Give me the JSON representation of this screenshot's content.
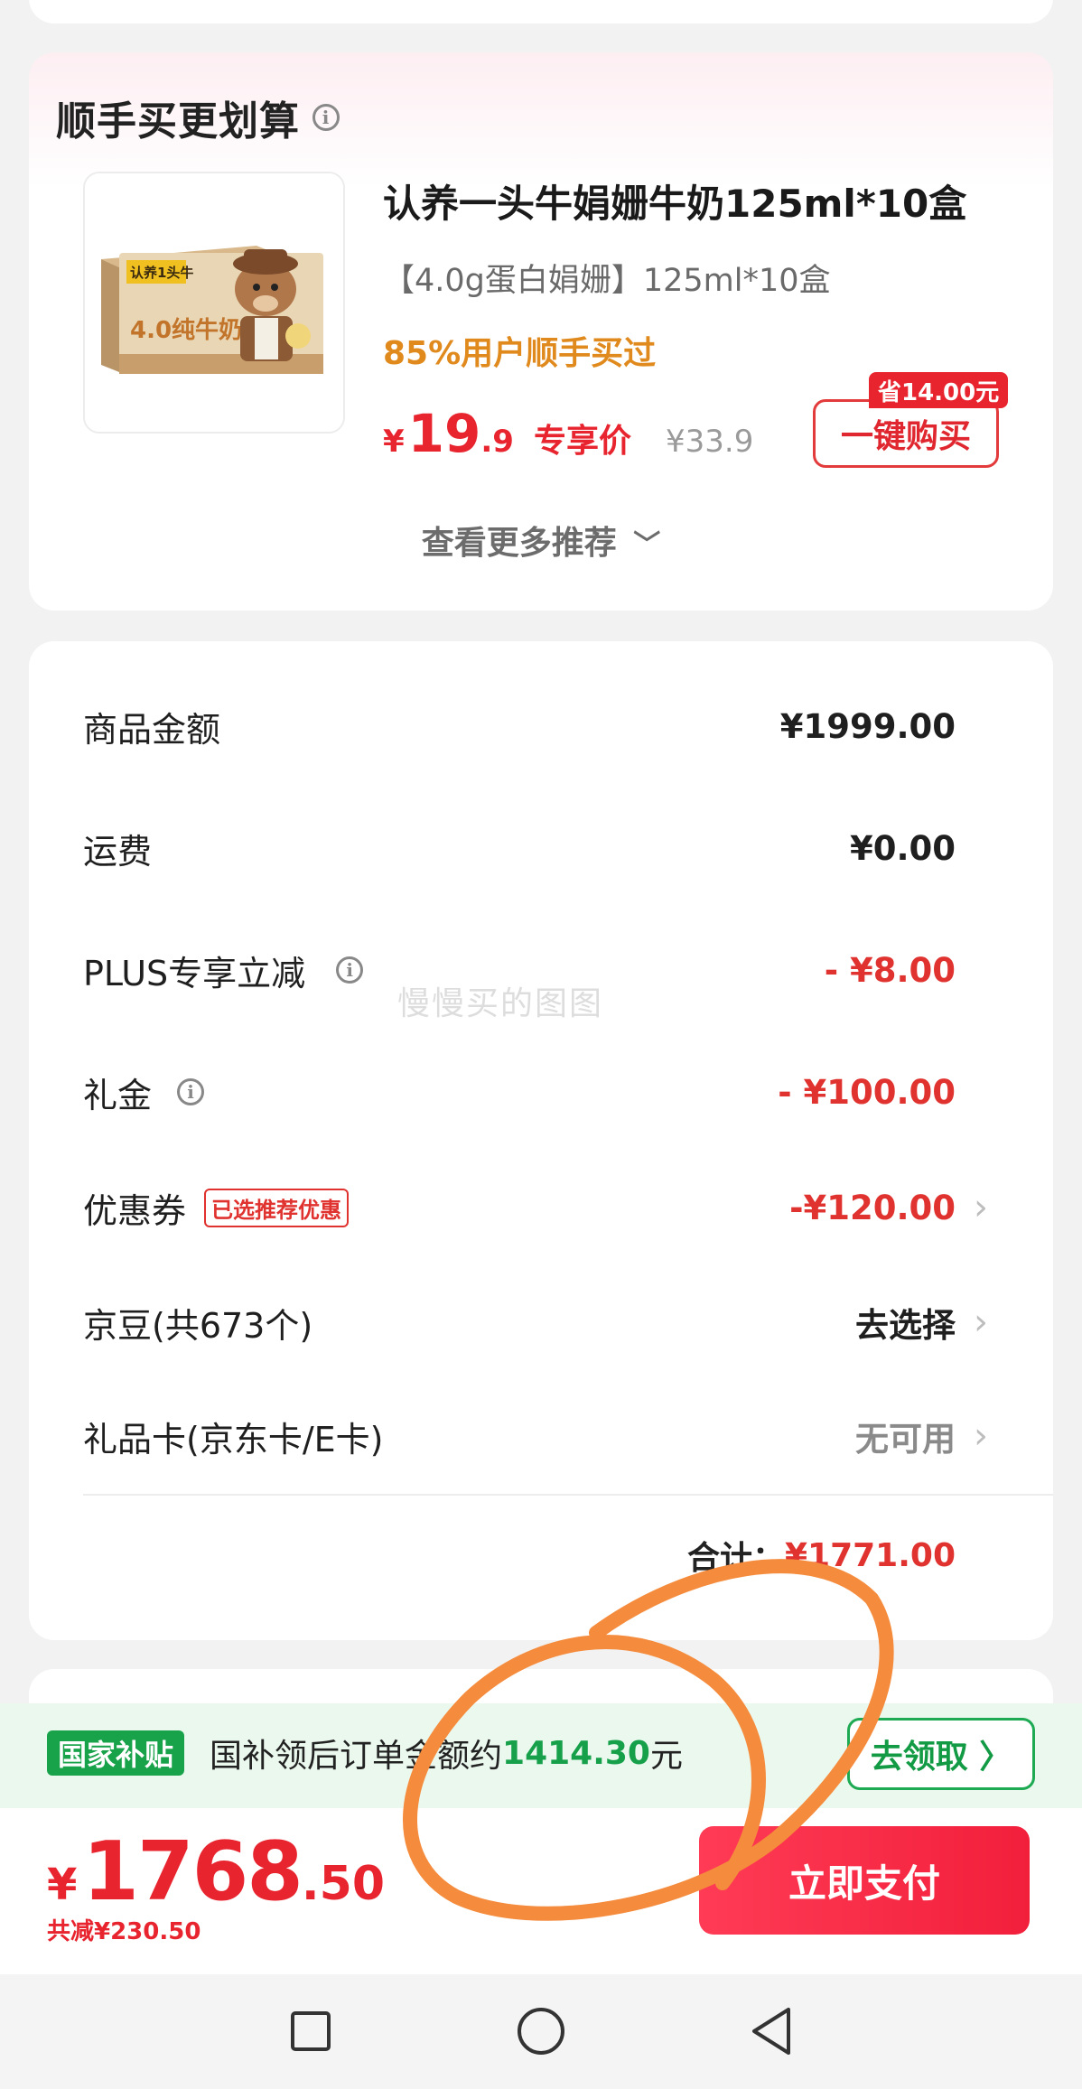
{
  "recommendation": {
    "title": "顺手买更划算",
    "product_name": "认养一头牛娟姗牛奶125ml*10盒",
    "product_spec": "【4.0g蛋白娟姗】125ml*10盒",
    "popularity_tag": "85%用户顺手买过",
    "price_symbol": "¥",
    "price_int": "19",
    "price_dec": ".9",
    "price_label": "专享价",
    "original_price": "¥33.9",
    "save_tag": "省14.00元",
    "buy_button": "一键购买",
    "more_link": "查看更多推荐",
    "thumb_brand": "认养1头牛",
    "thumb_text": "4.0纯牛奶"
  },
  "summary": {
    "rows": [
      {
        "label": "商品金额",
        "value": "¥1999.00"
      },
      {
        "label": "运费",
        "value": "¥0.00"
      },
      {
        "label": "PLUS专享立减",
        "value": "- ¥8.00"
      },
      {
        "label": "礼金",
        "value": "- ¥100.00"
      },
      {
        "label": "优惠券",
        "tag": "已选推荐优惠",
        "value": "-¥120.00"
      },
      {
        "label": "京豆(共673个)",
        "value": "去选择"
      },
      {
        "label": "礼品卡(京东卡/E卡)",
        "value": "无可用"
      }
    ],
    "total_label": "合计：",
    "total_value": "¥1771.00"
  },
  "subsidy": {
    "badge": "国家补贴",
    "text_prefix": "国补领后订单金额约",
    "amount": "1414.30",
    "text_suffix": "元",
    "claim_button": "去领取 〉"
  },
  "pay": {
    "symbol": "¥",
    "amount_int": "1768",
    "amount_dec": ".50",
    "saved": "共减¥230.50",
    "pay_button": "立即支付"
  },
  "watermark": "慢慢买的图图",
  "colors": {
    "price_red": "#e8242f",
    "subsidy_green": "#16a04a",
    "annotation_orange": "#f58b3c"
  }
}
